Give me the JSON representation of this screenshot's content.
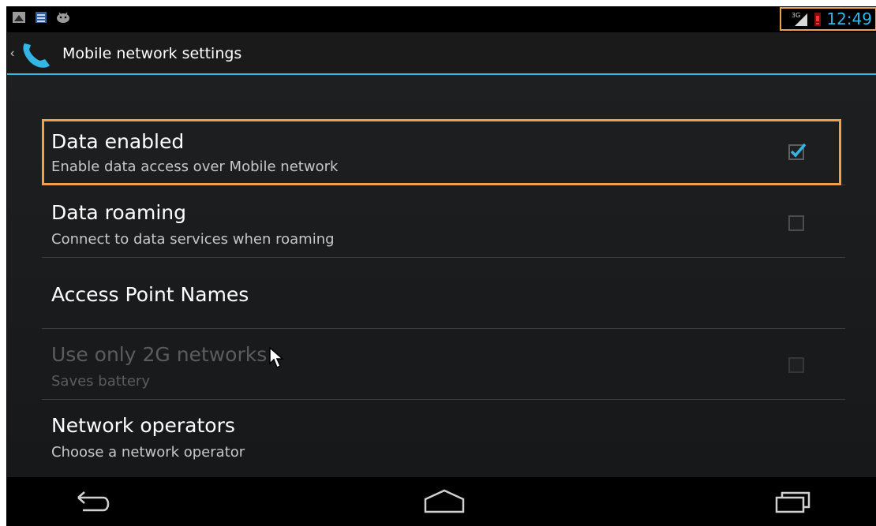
{
  "status_bar": {
    "notification_icons": [
      "screenshot-icon",
      "calendar-icon",
      "android-icon"
    ],
    "network_type": "3G",
    "time": "12:49",
    "accent_color": "#33b5e5"
  },
  "action_bar": {
    "title": "Mobile network settings",
    "icon": "phone-icon"
  },
  "preferences": [
    {
      "title": "Data enabled",
      "summary": "Enable data access over Mobile network",
      "checked": true,
      "enabled": true
    },
    {
      "title": "Data roaming",
      "summary": "Connect to data services when roaming",
      "checked": false,
      "enabled": true
    },
    {
      "title": "Access Point Names",
      "summary": "",
      "enabled": true
    },
    {
      "title": "Use only 2G networks",
      "summary": "Saves battery",
      "checked": false,
      "enabled": false
    },
    {
      "title": "Network operators",
      "summary": "Choose a network operator",
      "enabled": true
    }
  ],
  "nav_bar": {
    "buttons": [
      "back-icon",
      "home-icon",
      "recent-apps-icon"
    ]
  },
  "highlight_color": "#f0a04b"
}
